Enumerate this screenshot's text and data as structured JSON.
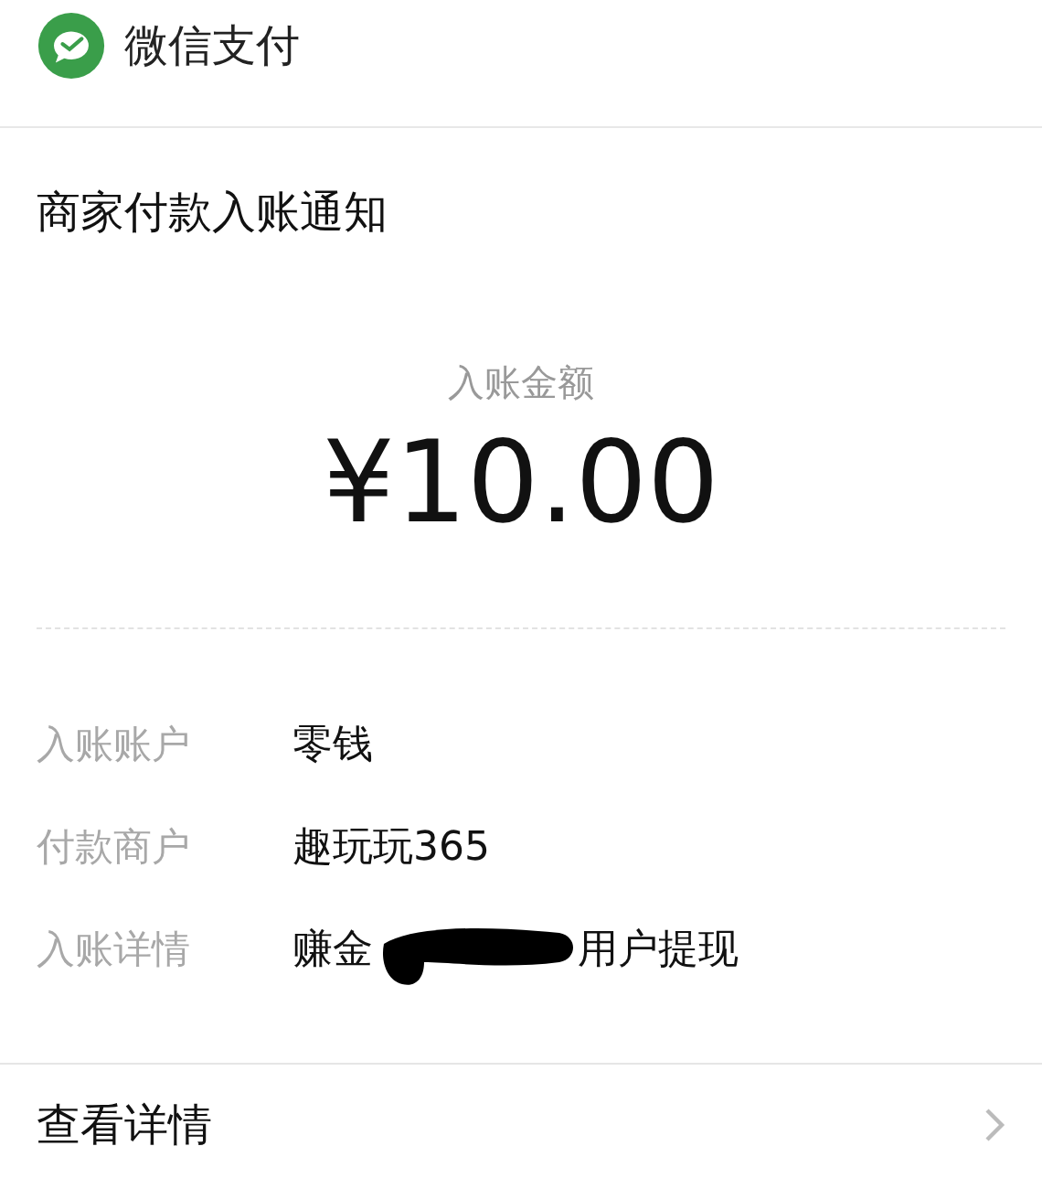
{
  "app": {
    "name": "微信支付"
  },
  "notice": {
    "title": "商家付款入账通知",
    "amount_label": "入账金额",
    "amount": "¥10.00",
    "rows": [
      {
        "label": "入账账户",
        "values": [
          {
            "kind": "text",
            "text": "零钱"
          }
        ]
      },
      {
        "label": "付款商户",
        "values": [
          {
            "kind": "text",
            "text": "趣玩玩365"
          }
        ]
      },
      {
        "label": "入账详情",
        "values": [
          {
            "kind": "text",
            "text": "赚金"
          },
          {
            "kind": "redaction"
          },
          {
            "kind": "text",
            "text": "用户提现"
          }
        ]
      }
    ]
  },
  "footer": {
    "link": "查看详情"
  }
}
